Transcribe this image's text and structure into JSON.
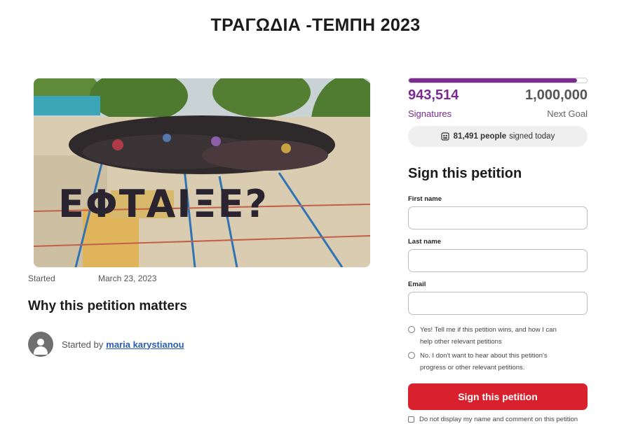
{
  "page": {
    "title": "ΤΡΑΓΩΔΙΑ -ΤΕΜΠΗ 2023"
  },
  "photo": {
    "formation_text": "ΕΦΤΑΙΞΕ?"
  },
  "petition_meta": {
    "started_label": "Started",
    "started_date": "March 23, 2023",
    "why_heading": "Why this petition matters",
    "started_by_label": "Started by",
    "author_name": "maria karystianou"
  },
  "progress": {
    "signatures_count": "943,514",
    "signatures_label": "Signatures",
    "goal_count": "1,000,000",
    "goal_label": "Next Goal",
    "fill_fraction": 0.9435,
    "today_count": "81,491 people",
    "today_suffix": "signed today"
  },
  "form": {
    "heading": "Sign this petition",
    "first_name_label": "First name",
    "last_name_label": "Last name",
    "email_label": "Email",
    "first_name_value": "",
    "last_name_value": "",
    "email_value": "",
    "opt_in_line1": "Yes! Tell me if this petition wins, and how I can",
    "opt_in_line2": "help other relevant petitions",
    "opt_out_line1": "No. I don't want to hear about this petition's",
    "opt_out_line2": "progress or other relevant petitions.",
    "submit_label": "Sign this petition",
    "disclose_label": "Do not display my name and comment on this petition"
  },
  "colors": {
    "accent_purple": "#7b2a8e",
    "button_red": "#d8212c",
    "link_blue": "#2a5db0"
  }
}
